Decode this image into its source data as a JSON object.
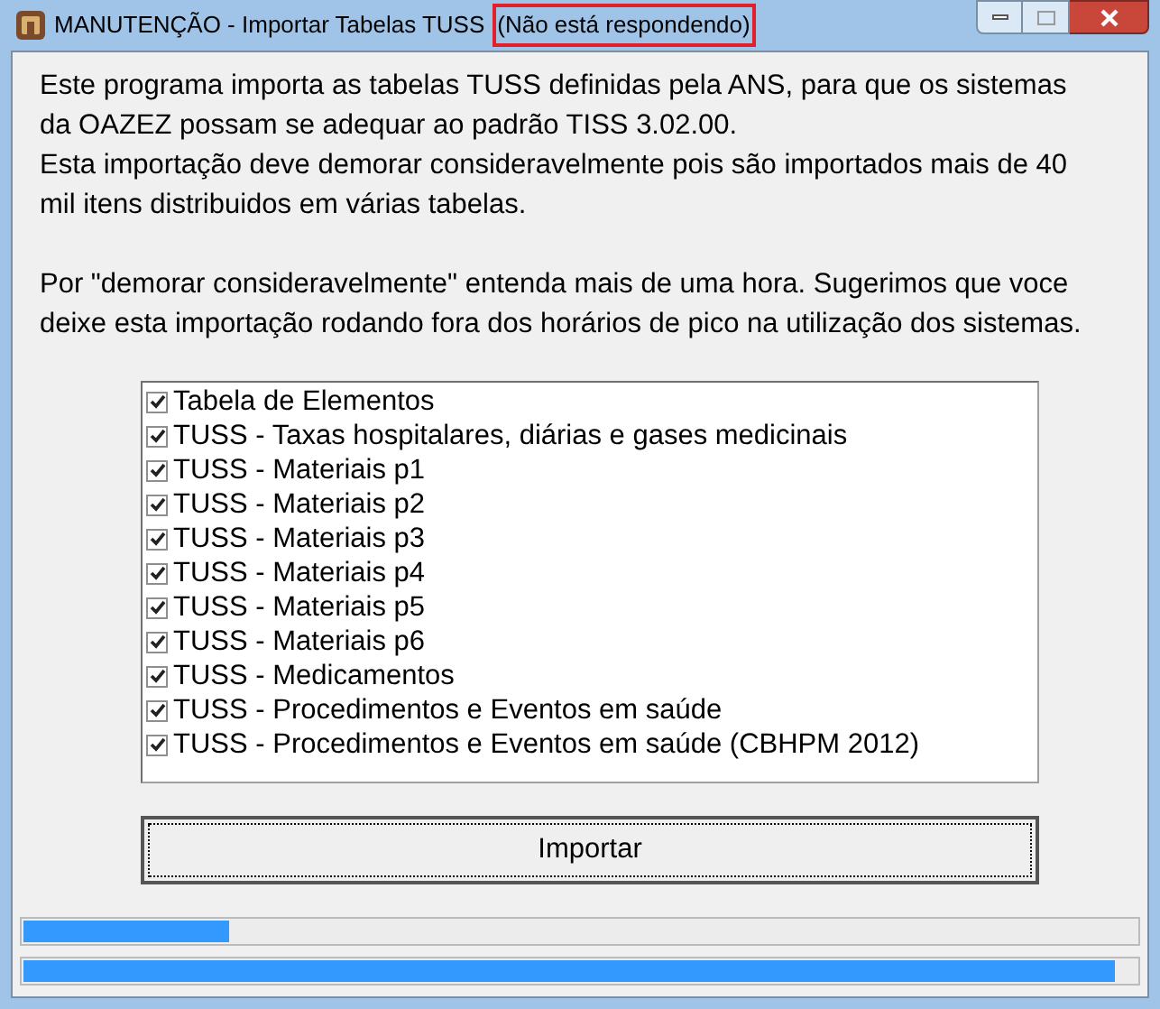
{
  "window": {
    "title": "MANUTENÇÃO - Importar Tabelas TUSS",
    "status": "(Não está respondendo)"
  },
  "intro": [
    [
      "Este programa importa as tabelas TUSS definidas pela ANS, para que os sistemas",
      "da OAZEZ possam se adequar ao padrão TISS 3.02.00.",
      "Esta importação deve demorar consideravelmente pois são importados mais de 40",
      "mil itens distribuidos em várias tabelas."
    ],
    [
      "Por \"demorar consideravelmente\" entenda mais de uma hora. Sugerimos que voce",
      "deixe esta importação rodando fora dos horários de pico na utilização dos sistemas."
    ]
  ],
  "tables": [
    {
      "label": "Tabela de Elementos",
      "checked": true
    },
    {
      "label": "TUSS - Taxas hospitalares, diárias e gases medicinais",
      "checked": true
    },
    {
      "label": "TUSS - Materiais p1",
      "checked": true
    },
    {
      "label": "TUSS - Materiais p2",
      "checked": true
    },
    {
      "label": "TUSS - Materiais p3",
      "checked": true
    },
    {
      "label": "TUSS - Materiais p4",
      "checked": true
    },
    {
      "label": "TUSS - Materiais p5",
      "checked": true
    },
    {
      "label": "TUSS - Materiais p6",
      "checked": true
    },
    {
      "label": "TUSS - Medicamentos",
      "checked": true
    },
    {
      "label": "TUSS - Procedimentos e Eventos em saúde",
      "checked": true
    },
    {
      "label": "TUSS - Procedimentos e Eventos em saúde (CBHPM 2012)",
      "checked": true
    }
  ],
  "button": "Importar",
  "progress": [
    {
      "level": 0.185
    },
    {
      "level": 0.98
    }
  ]
}
